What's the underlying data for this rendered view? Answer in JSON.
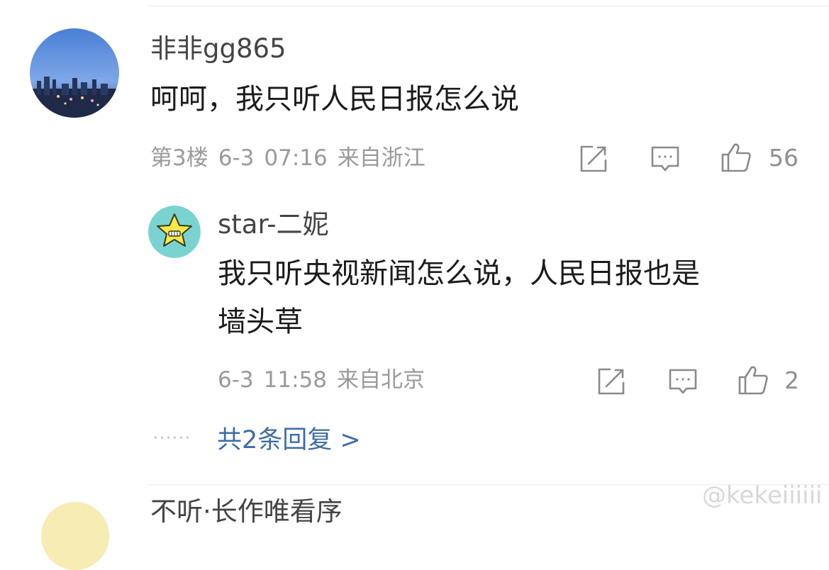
{
  "comment": {
    "username": "非非gg865",
    "text": "呵呵，我只听人民日报怎么说",
    "floor": "第3楼",
    "date": "6-3",
    "time": "07:16",
    "location": "来自浙江",
    "likes": "56"
  },
  "reply": {
    "username": "star-二妮",
    "text_line1": "我只听央视新闻怎么说，人民日报也是",
    "text_line2": "墙头草",
    "date": "6-3",
    "time": "11:58",
    "location": "来自北京",
    "likes": "2"
  },
  "replies_link": {
    "dots": "······",
    "label": "共2条回复 >"
  },
  "next_comment": {
    "username_partial": "不听·长作唯看序"
  },
  "watermark": "@kekeiiiiii",
  "icons": {
    "share": "share-edit-icon",
    "comment": "comment-bubble-icon",
    "like": "thumbs-up-icon"
  },
  "colors": {
    "link": "#3f6da6",
    "meta": "#9a9a9a",
    "text": "#1b1b1b"
  }
}
